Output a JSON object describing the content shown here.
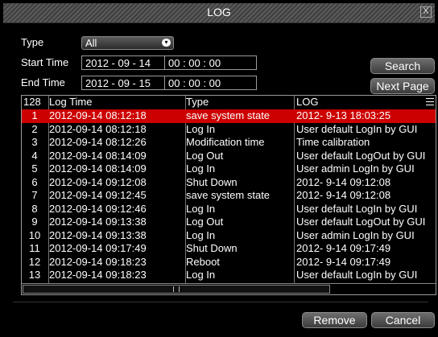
{
  "window": {
    "title": "LOG",
    "close_glyph": "X"
  },
  "filters": {
    "type_label": "Type",
    "type_value": "All",
    "start_label": "Start Time",
    "start_date": "2012 - 09 - 14",
    "start_time": "00 : 00 : 00",
    "end_label": "End Time",
    "end_date": "2012 - 09 - 15",
    "end_time": "00 : 00 : 00"
  },
  "buttons": {
    "search": "Search",
    "next_page": "Next Page",
    "remove": "Remove",
    "cancel": "Cancel"
  },
  "table": {
    "headers": {
      "count": "128",
      "log_time": "Log Time",
      "type": "Type",
      "log": "LOG"
    },
    "selected_index": 0,
    "rows": [
      {
        "num": "1",
        "time": "2012-09-14 08:12:18",
        "type": "save system state",
        "log": "2012- 9-13 18:03:25"
      },
      {
        "num": "2",
        "time": "2012-09-14 08:12:18",
        "type": "Log In",
        "log": "User default LogIn by GUI"
      },
      {
        "num": "3",
        "time": "2012-09-14 08:12:26",
        "type": "Modification time",
        "log": "Time calibration"
      },
      {
        "num": "4",
        "time": "2012-09-14 08:14:09",
        "type": "Log Out",
        "log": "User default LogOut by GUI"
      },
      {
        "num": "5",
        "time": "2012-09-14 08:14:09",
        "type": "Log In",
        "log": "User admin LogIn by GUI"
      },
      {
        "num": "6",
        "time": "2012-09-14 09:12:08",
        "type": "Shut Down",
        "log": "2012- 9-14 09:12:08"
      },
      {
        "num": "7",
        "time": "2012-09-14 09:12:45",
        "type": "save system state",
        "log": "2012- 9-14 09:12:08"
      },
      {
        "num": "8",
        "time": "2012-09-14 09:12:46",
        "type": "Log In",
        "log": "User default LogIn by GUI"
      },
      {
        "num": "9",
        "time": "2012-09-14 09:13:38",
        "type": "Log Out",
        "log": "User default LogOut by GUI"
      },
      {
        "num": "10",
        "time": "2012-09-14 09:13:38",
        "type": "Log In",
        "log": "User admin LogIn by GUI"
      },
      {
        "num": "11",
        "time": "2012-09-14 09:17:49",
        "type": "Shut Down",
        "log": "2012- 9-14 09:17:49"
      },
      {
        "num": "12",
        "time": "2012-09-14 09:18:23",
        "type": "Reboot",
        "log": "2012- 9-14 09:17:49"
      },
      {
        "num": "13",
        "time": "2012-09-14 09:18:23",
        "type": "Log In",
        "log": "User default LogIn by GUI"
      }
    ]
  },
  "colors": {
    "selected_row": "#cc0000",
    "background": "#000000"
  }
}
